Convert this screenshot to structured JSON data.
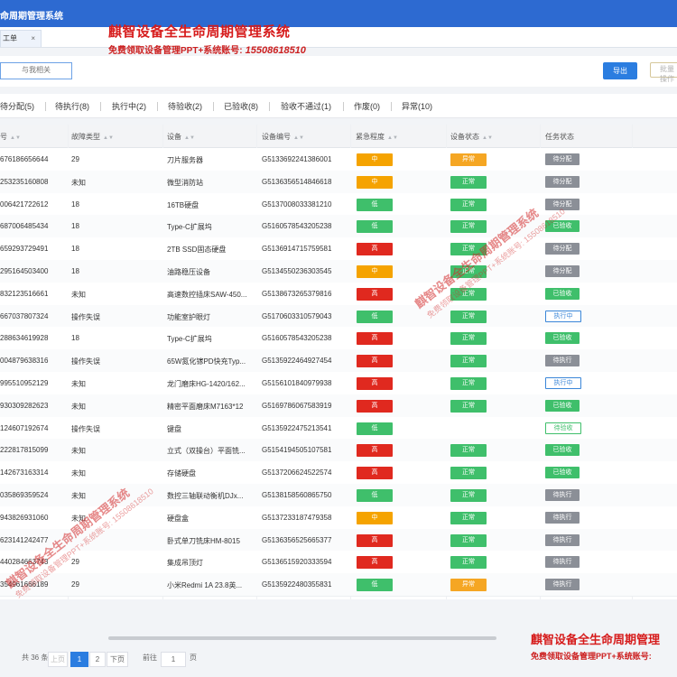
{
  "app": {
    "title": "命周期管理系统"
  },
  "tab": {
    "label": "工单",
    "close": "×"
  },
  "watermark": {
    "line1": "麒智设备全生命周期管理系统",
    "line2": "免费领取设备管理PPT+系统账号:",
    "phone": "15508618510",
    "bottom_line1": "麒智设备全生命周期管理",
    "bottom_line2": "免费领取设备管理PPT+系统账号:",
    "diag1": "麒智设备全生命周期管理系统",
    "diag2": "免费领取设备管理PPT+系统账号: 15508618510"
  },
  "toolbar": {
    "search_placeholder": "与我相关",
    "export_label": "导出",
    "more_label": "批量操作"
  },
  "status_tabs": [
    "待分配(5)",
    "待执行(8)",
    "执行中(2)",
    "待验收(2)",
    "已验收(8)",
    "验收不通过(1)",
    "作废(0)",
    "异常(10)"
  ],
  "columns": {
    "no": "号",
    "fault": "故障类型",
    "device": "设备",
    "code": "设备编号",
    "urgency": "紧急程度",
    "dev_status": "设备状态",
    "task_status": "任务状态"
  },
  "colors": {
    "urg_high": "#e0291f",
    "urg_mid": "#f5a300",
    "urg_low": "#3fbf6b",
    "dev_ok": "#3fbf6b",
    "dev_err": "#f5a623",
    "task_gray": "#8b8f97",
    "task_green": "#3fbf6b",
    "task_blue": "#3a86d8",
    "task_green_outline": "#3fbf6b"
  },
  "rows": [
    {
      "no": "676186656644",
      "fault": "29",
      "device": "刀片服务器",
      "code": "G5133692241386001",
      "urgency": "中",
      "urgency_level": "mid",
      "dev": "异常",
      "dev_level": "err",
      "task": "待分配",
      "task_style": "gray"
    },
    {
      "no": "253235160808",
      "fault": "未知",
      "device": "微型消防站",
      "code": "G5136356514846618",
      "urgency": "中",
      "urgency_level": "mid",
      "dev": "正常",
      "dev_level": "ok",
      "task": "待分配",
      "task_style": "gray"
    },
    {
      "no": "006421722612",
      "fault": "18",
      "device": "16TB硬盘",
      "code": "G5137008033381210",
      "urgency": "低",
      "urgency_level": "low",
      "dev": "正常",
      "dev_level": "ok",
      "task": "待分配",
      "task_style": "gray"
    },
    {
      "no": "687006485434",
      "fault": "18",
      "device": "Type-C扩展坞",
      "code": "G5160578543205238",
      "urgency": "低",
      "urgency_level": "low",
      "dev": "正常",
      "dev_level": "ok",
      "task": "已验收",
      "task_style": "green"
    },
    {
      "no": "659293729491",
      "fault": "18",
      "device": "2TB SSD固态硬盘",
      "code": "G5136914715759581",
      "urgency": "高",
      "urgency_level": "high",
      "dev": "正常",
      "dev_level": "ok",
      "task": "待分配",
      "task_style": "gray"
    },
    {
      "no": "295164503400",
      "fault": "18",
      "device": "油路稳压设备",
      "code": "G5134550236303545",
      "urgency": "中",
      "urgency_level": "mid",
      "dev": "正常",
      "dev_level": "ok",
      "task": "待分配",
      "task_style": "gray"
    },
    {
      "no": "832123516661",
      "fault": "未知",
      "device": "高速数控插床SAW-450...",
      "code": "G5138673265379816",
      "urgency": "高",
      "urgency_level": "high",
      "dev": "正常",
      "dev_level": "ok",
      "task": "已验收",
      "task_style": "green"
    },
    {
      "no": "667037807324",
      "fault": "操作失误",
      "device": "功能室护眼灯",
      "code": "G5170603310579043",
      "urgency": "低",
      "urgency_level": "low",
      "dev": "正常",
      "dev_level": "ok",
      "task": "执行中",
      "task_style": "blue"
    },
    {
      "no": "288634619928",
      "fault": "18",
      "device": "Type-C扩展坞",
      "code": "G5160578543205238",
      "urgency": "高",
      "urgency_level": "high",
      "dev": "正常",
      "dev_level": "ok",
      "task": "已验收",
      "task_style": "green"
    },
    {
      "no": "004879638316",
      "fault": "操作失误",
      "device": "65W氮化镓PD快充Typ...",
      "code": "G5135922464927454",
      "urgency": "高",
      "urgency_level": "high",
      "dev": "正常",
      "dev_level": "ok",
      "task": "待执行",
      "task_style": "gray"
    },
    {
      "no": "995510952129",
      "fault": "未知",
      "device": "龙门磨床HG-1420/162...",
      "code": "G5156101840979938",
      "urgency": "高",
      "urgency_level": "high",
      "dev": "正常",
      "dev_level": "ok",
      "task": "执行中",
      "task_style": "blue"
    },
    {
      "no": "930309282623",
      "fault": "未知",
      "device": "精密平面磨床M7163*12",
      "code": "G5169786067583919",
      "urgency": "高",
      "urgency_level": "high",
      "dev": "正常",
      "dev_level": "ok",
      "task": "已验收",
      "task_style": "green"
    },
    {
      "no": "124607192674",
      "fault": "操作失误",
      "device": "键盘",
      "code": "G5135922475213541",
      "urgency": "低",
      "urgency_level": "low",
      "dev": "",
      "dev_level": "none",
      "task": "待验收",
      "task_style": "green-outline"
    },
    {
      "no": "222817815099",
      "fault": "未知",
      "device": "立式（双操台）平面铣...",
      "code": "G5154194505107581",
      "urgency": "高",
      "urgency_level": "high",
      "dev": "正常",
      "dev_level": "ok",
      "task": "已验收",
      "task_style": "green"
    },
    {
      "no": "142673163314",
      "fault": "未知",
      "device": "存储硬盘",
      "code": "G5137206624522574",
      "urgency": "高",
      "urgency_level": "high",
      "dev": "正常",
      "dev_level": "ok",
      "task": "已验收",
      "task_style": "green"
    },
    {
      "no": "035869359524",
      "fault": "未知",
      "device": "数控三轴联动衡机DJx...",
      "code": "G5138158560865750",
      "urgency": "低",
      "urgency_level": "low",
      "dev": "正常",
      "dev_level": "ok",
      "task": "待执行",
      "task_style": "gray"
    },
    {
      "no": "943826931060",
      "fault": "未知",
      "device": "硬盘盒",
      "code": "G5137233187479358",
      "urgency": "中",
      "urgency_level": "mid",
      "dev": "正常",
      "dev_level": "ok",
      "task": "待执行",
      "task_style": "gray"
    },
    {
      "no": "623141242477",
      "fault": "",
      "device": "卧式单刀铣床HM-8015",
      "code": "G5136356525665377",
      "urgency": "高",
      "urgency_level": "high",
      "dev": "正常",
      "dev_level": "ok",
      "task": "待执行",
      "task_style": "gray"
    },
    {
      "no": "440284663743",
      "fault": "29",
      "device": "集成吊顶灯",
      "code": "G5136515920333594",
      "urgency": "高",
      "urgency_level": "high",
      "dev": "正常",
      "dev_level": "ok",
      "task": "待执行",
      "task_style": "gray"
    },
    {
      "no": "354961666189",
      "fault": "29",
      "device": "小米Redmi 1A 23.8英...",
      "code": "G5135922480355831",
      "urgency": "低",
      "urgency_level": "low",
      "dev": "异常",
      "dev_level": "err",
      "task": "待执行",
      "task_style": "gray"
    }
  ],
  "pager": {
    "total": "共 36 条",
    "prev": "上页",
    "page1": "1",
    "page2": "2",
    "next": "下页",
    "goto": "前往",
    "page_input": "1",
    "page_unit": "页"
  }
}
